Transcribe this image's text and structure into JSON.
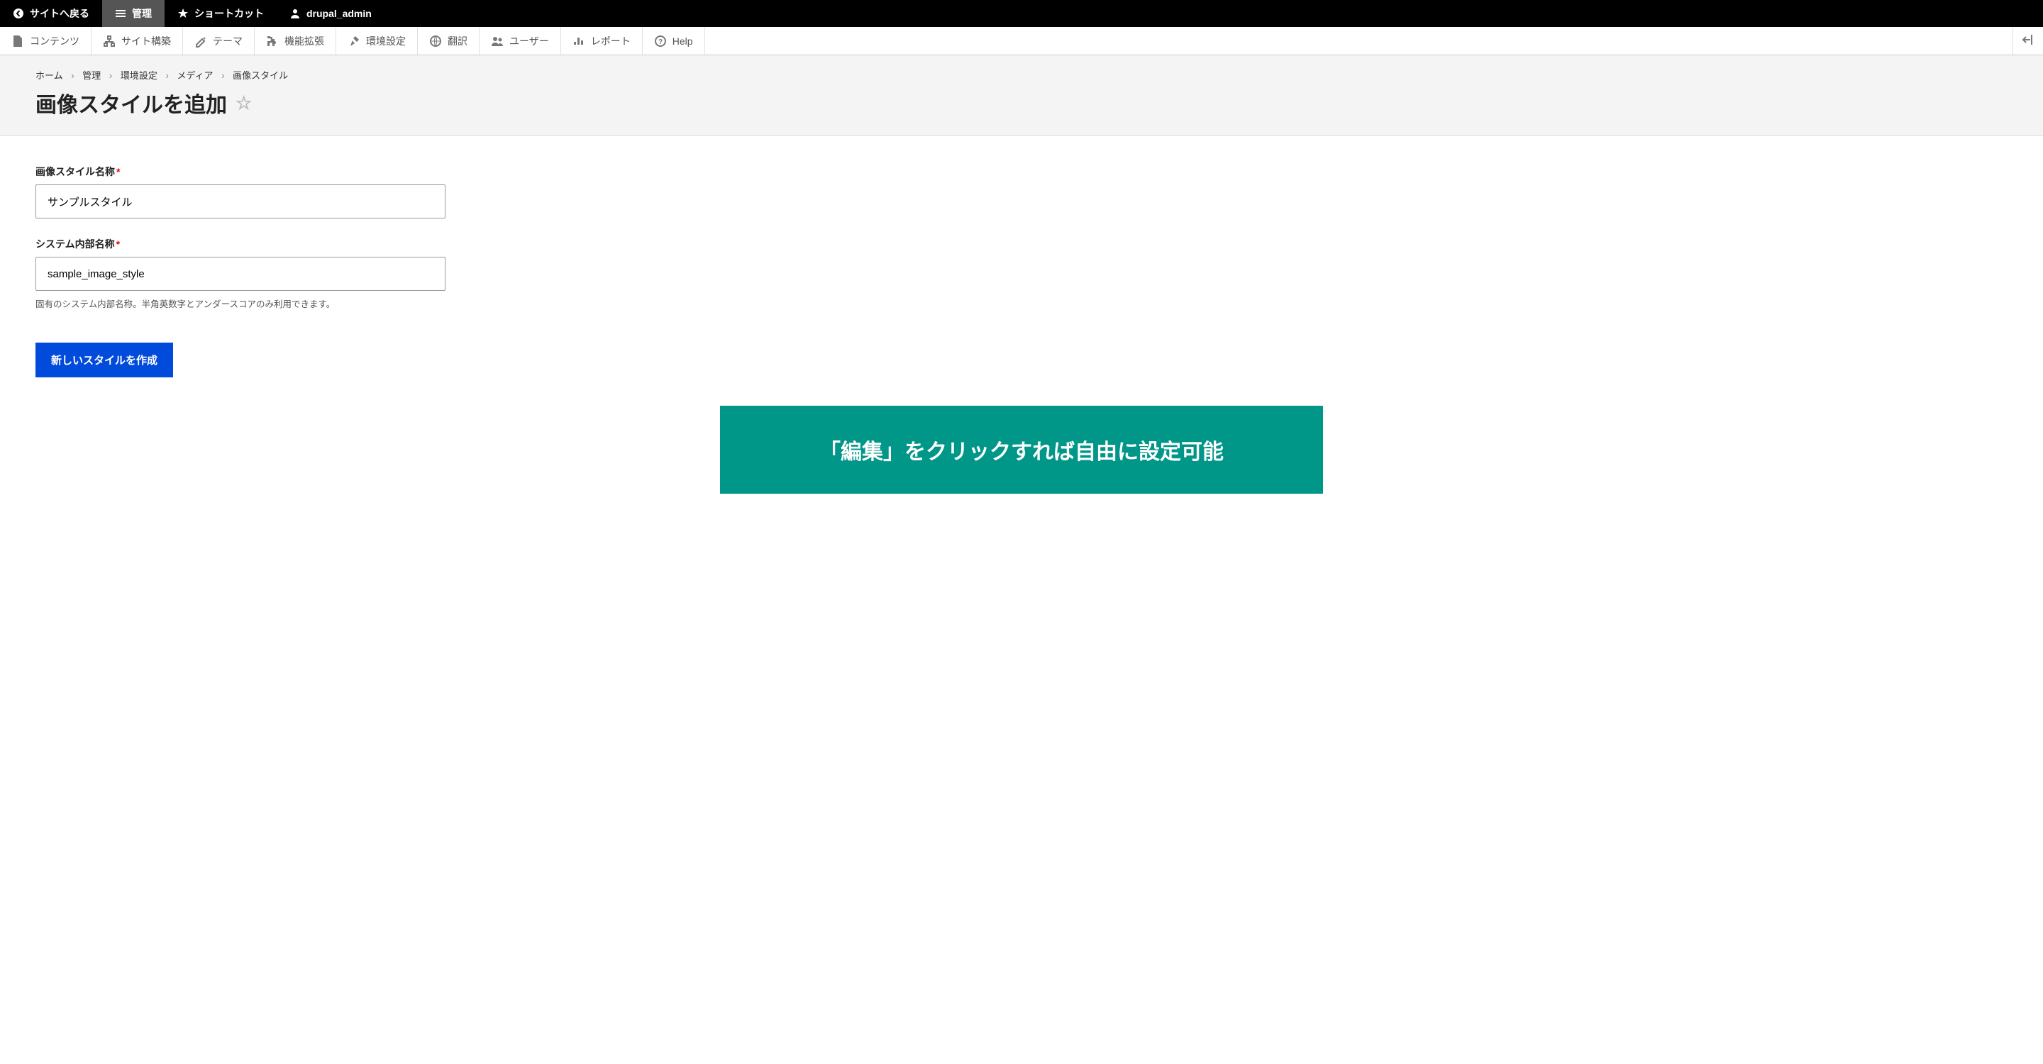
{
  "toolbar_top": {
    "back": "サイトへ戻る",
    "manage": "管理",
    "shortcuts": "ショートカット",
    "user": "drupal_admin"
  },
  "toolbar_admin": [
    {
      "label": "コンテンツ",
      "icon": "file"
    },
    {
      "label": "サイト構築",
      "icon": "structure"
    },
    {
      "label": "テーマ",
      "icon": "appearance"
    },
    {
      "label": "機能拡張",
      "icon": "extend"
    },
    {
      "label": "環境設定",
      "icon": "config"
    },
    {
      "label": "翻訳",
      "icon": "translate"
    },
    {
      "label": "ユーザー",
      "icon": "people"
    },
    {
      "label": "レポート",
      "icon": "reports"
    },
    {
      "label": "Help",
      "icon": "help"
    }
  ],
  "breadcrumb": [
    "ホーム",
    "管理",
    "環境設定",
    "メディア",
    "画像スタイル"
  ],
  "page_title": "画像スタイルを追加",
  "form": {
    "name_label": "画像スタイル名称",
    "name_value": "サンプルスタイル",
    "machine_label": "システム内部名称",
    "machine_value": "sample_image_style",
    "machine_desc": "固有のシステム内部名称。半角英数字とアンダースコアのみ利用できます。",
    "submit": "新しいスタイルを作成"
  },
  "annotation": "「編集」をクリックすれば自由に設定可能"
}
